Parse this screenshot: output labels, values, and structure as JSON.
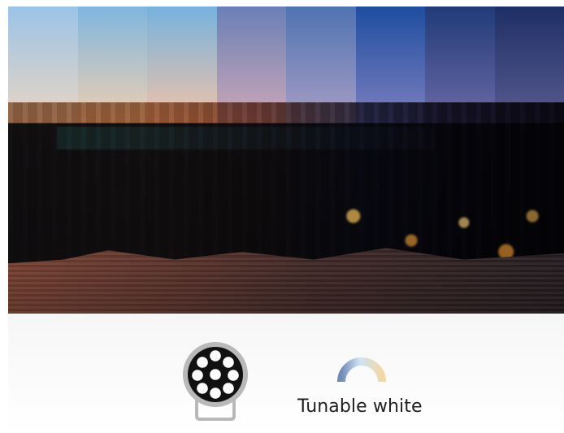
{
  "bottom": {
    "tunable_label": "Tunable white"
  },
  "icons": {
    "fixture": "led-fixture-icon",
    "tunable": "tunable-white-arc-icon"
  },
  "colors": {
    "strip_tops": [
      "#9cc3e8",
      "#7fb6df",
      "#76b2de",
      "#6a7fb7",
      "#4f73b2",
      "#1f4ea0",
      "#213b79",
      "#1d2f66"
    ],
    "strip_bottoms": [
      "#e9d6c2",
      "#f0cfb0",
      "#f3c3a8",
      "#cfa8b7",
      "#a99ec5",
      "#7e7fbf",
      "#6c6aa7",
      "#5a5b8f"
    ],
    "label_text": "#1f1f1f",
    "icon_dark": "#111111"
  }
}
